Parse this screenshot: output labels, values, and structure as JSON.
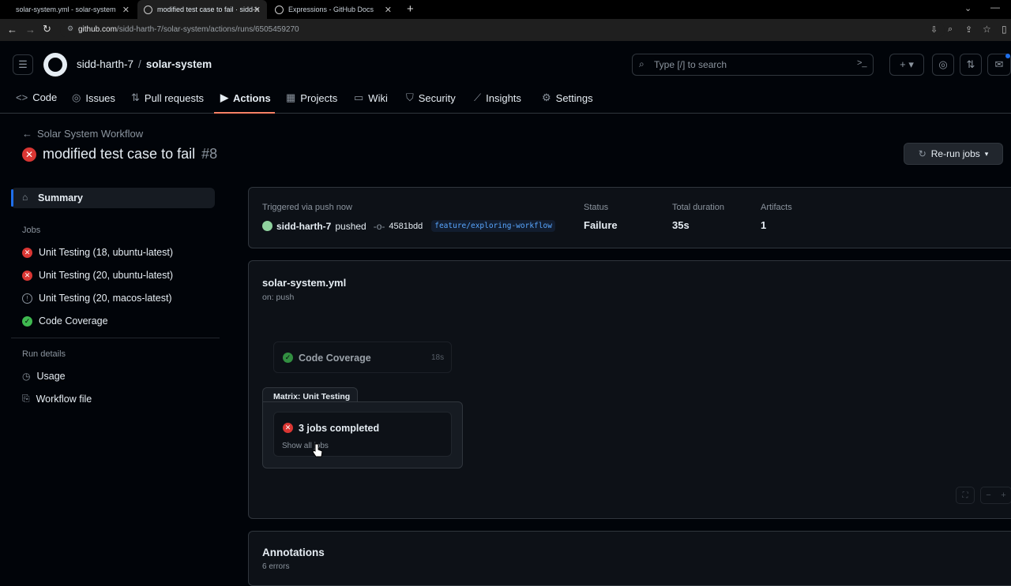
{
  "browser": {
    "tabs": [
      {
        "title": "solar-system.yml - solar-system"
      },
      {
        "title": "modified test case to fail · sidd-h"
      },
      {
        "title": "Expressions - GitHub Docs"
      }
    ],
    "url_host": "github.com",
    "url_path": "/sidd-harth-7/solar-system/actions/runs/6505459270"
  },
  "header": {
    "owner": "sidd-harth-7",
    "separator": "/",
    "repo": "solar-system",
    "search_placeholder": "Type [/] to search"
  },
  "repo_nav": [
    {
      "label": "Code",
      "icon": "code-icon"
    },
    {
      "label": "Issues",
      "icon": "issue-icon"
    },
    {
      "label": "Pull requests",
      "icon": "pull-request-icon"
    },
    {
      "label": "Actions",
      "icon": "play-icon"
    },
    {
      "label": "Projects",
      "icon": "table-icon"
    },
    {
      "label": "Wiki",
      "icon": "book-icon"
    },
    {
      "label": "Security",
      "icon": "shield-icon"
    },
    {
      "label": "Insights",
      "icon": "graph-icon"
    },
    {
      "label": "Settings",
      "icon": "gear-icon"
    }
  ],
  "run": {
    "back_label": "Solar System Workflow",
    "title": "modified test case to fail",
    "number": "#8",
    "rerun_label": "Re-run jobs"
  },
  "sidebar": {
    "summary_label": "Summary",
    "jobs_heading": "Jobs",
    "jobs": [
      {
        "label": "Unit Testing (18, ubuntu-latest)",
        "status": "failure"
      },
      {
        "label": "Unit Testing (20, ubuntu-latest)",
        "status": "failure"
      },
      {
        "label": "Unit Testing (20, macos-latest)",
        "status": "cancelled"
      },
      {
        "label": "Code Coverage",
        "status": "success"
      }
    ],
    "run_details_heading": "Run details",
    "details": [
      {
        "label": "Usage",
        "icon": "stopwatch-icon"
      },
      {
        "label": "Workflow file",
        "icon": "file-icon"
      }
    ]
  },
  "summary": {
    "triggered_label": "Triggered via push now",
    "actor": "sidd-harth-7",
    "pushed_word": "pushed",
    "commit": "4581bdd",
    "branch": "feature/exploring-workflow",
    "status_label": "Status",
    "status_value": "Failure",
    "duration_label": "Total duration",
    "duration_value": "35s",
    "artifacts_label": "Artifacts",
    "artifacts_value": "1"
  },
  "graph": {
    "file": "solar-system.yml",
    "trigger": "on: push",
    "coverage_job": "Code Coverage",
    "coverage_time": "18s",
    "matrix_label": "Matrix: Unit Testing",
    "matrix_summary": "3 jobs completed",
    "show_all": "Show all jobs"
  },
  "annotations": {
    "title": "Annotations",
    "count": "6 errors"
  }
}
